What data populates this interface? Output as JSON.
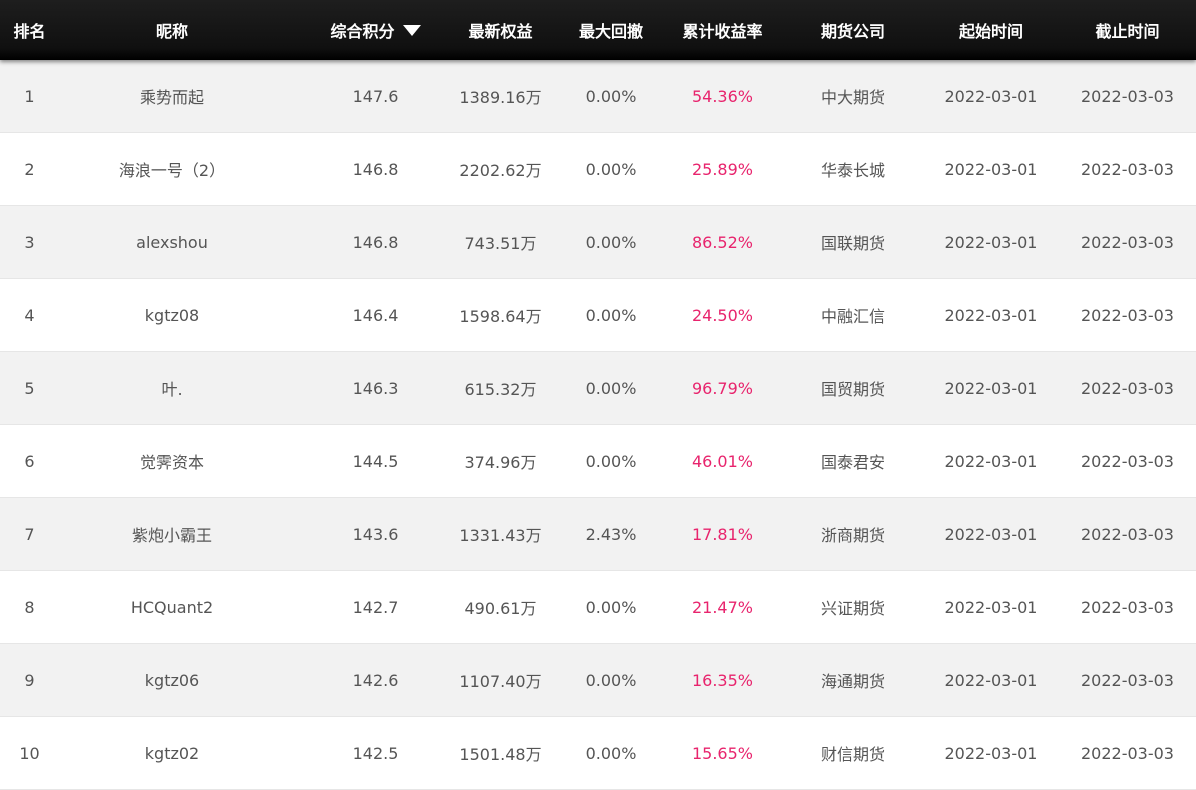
{
  "table": {
    "headers": {
      "rank": "排名",
      "nickname": "昵称",
      "score": "综合积分",
      "equity": "最新权益",
      "drawdown": "最大回撤",
      "return": "累计收益率",
      "company": "期货公司",
      "start": "起始时间",
      "end": "截止时间"
    },
    "sort_icon": "caret-down-icon",
    "colors": {
      "header_bg": "#0d0d0d",
      "row_alt": "#f2f2f2",
      "return_text": "#e8246d",
      "body_text": "#555555"
    },
    "rows": [
      {
        "rank": "1",
        "nickname": "乘势而起",
        "score": "147.6",
        "equity": "1389.16万",
        "drawdown": "0.00%",
        "return": "54.36%",
        "company": "中大期货",
        "start": "2022-03-01",
        "end": "2022-03-03"
      },
      {
        "rank": "2",
        "nickname": "海浪一号（2）",
        "score": "146.8",
        "equity": "2202.62万",
        "drawdown": "0.00%",
        "return": "25.89%",
        "company": "华泰长城",
        "start": "2022-03-01",
        "end": "2022-03-03"
      },
      {
        "rank": "3",
        "nickname": "alexshou",
        "score": "146.8",
        "equity": "743.51万",
        "drawdown": "0.00%",
        "return": "86.52%",
        "company": "国联期货",
        "start": "2022-03-01",
        "end": "2022-03-03"
      },
      {
        "rank": "4",
        "nickname": "kgtz08",
        "score": "146.4",
        "equity": "1598.64万",
        "drawdown": "0.00%",
        "return": "24.50%",
        "company": "中融汇信",
        "start": "2022-03-01",
        "end": "2022-03-03"
      },
      {
        "rank": "5",
        "nickname": "叶.",
        "score": "146.3",
        "equity": "615.32万",
        "drawdown": "0.00%",
        "return": "96.79%",
        "company": "国贸期货",
        "start": "2022-03-01",
        "end": "2022-03-03"
      },
      {
        "rank": "6",
        "nickname": "觉霁资本",
        "score": "144.5",
        "equity": "374.96万",
        "drawdown": "0.00%",
        "return": "46.01%",
        "company": "国泰君安",
        "start": "2022-03-01",
        "end": "2022-03-03"
      },
      {
        "rank": "7",
        "nickname": "紫炮小霸王",
        "score": "143.6",
        "equity": "1331.43万",
        "drawdown": "2.43%",
        "return": "17.81%",
        "company": "浙商期货",
        "start": "2022-03-01",
        "end": "2022-03-03"
      },
      {
        "rank": "8",
        "nickname": "HCQuant2",
        "score": "142.7",
        "equity": "490.61万",
        "drawdown": "0.00%",
        "return": "21.47%",
        "company": "兴证期货",
        "start": "2022-03-01",
        "end": "2022-03-03"
      },
      {
        "rank": "9",
        "nickname": "kgtz06",
        "score": "142.6",
        "equity": "1107.40万",
        "drawdown": "0.00%",
        "return": "16.35%",
        "company": "海通期货",
        "start": "2022-03-01",
        "end": "2022-03-03"
      },
      {
        "rank": "10",
        "nickname": "kgtz02",
        "score": "142.5",
        "equity": "1501.48万",
        "drawdown": "0.00%",
        "return": "15.65%",
        "company": "财信期货",
        "start": "2022-03-01",
        "end": "2022-03-03"
      }
    ]
  }
}
